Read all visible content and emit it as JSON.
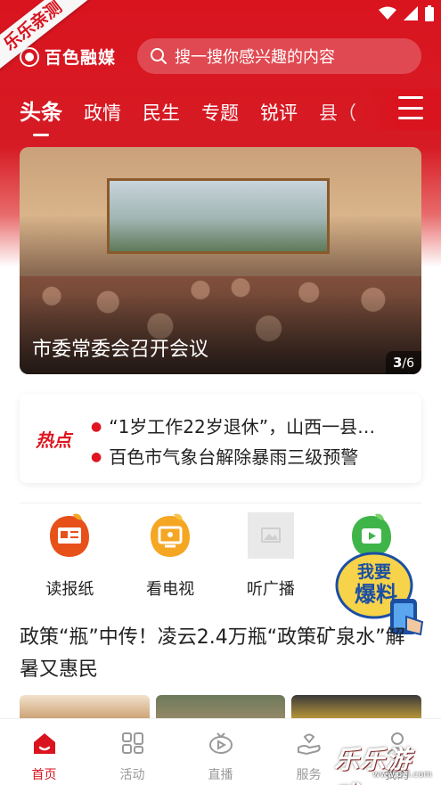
{
  "status_bar": {
    "icons": [
      "wifi-icon",
      "cellular-signal-icon",
      "battery-icon"
    ]
  },
  "ribbon": {
    "text": "乐乐亲测"
  },
  "app": {
    "name": "百色融媒"
  },
  "search": {
    "placeholder": "搜一搜你感兴趣的内容"
  },
  "tabs": [
    {
      "label": "头条",
      "active": true
    },
    {
      "label": "政情"
    },
    {
      "label": "民生"
    },
    {
      "label": "专题"
    },
    {
      "label": "锐评"
    },
    {
      "label": "县（"
    }
  ],
  "banner": {
    "title": "市委常委会召开会议",
    "page_current": "3",
    "page_total": "/6"
  },
  "hot": {
    "label": "热点",
    "items": [
      "“1岁工作22岁退休”，山西一县…",
      "百色市气象台解除暴雨三级预警"
    ]
  },
  "shortcuts": [
    {
      "label": "读报纸",
      "icon": "newspaper-icon"
    },
    {
      "label": "看电视",
      "icon": "tv-icon"
    },
    {
      "label": "听广播",
      "icon": "image-placeholder-icon"
    },
    {
      "label": "",
      "icon": "video-play-icon"
    }
  ],
  "report_button": {
    "line1": "我要",
    "line2": "爆料"
  },
  "headline": {
    "text": "政策“瓶”中传！凌云2.4万瓶“政策矿泉水”解暑又惠民"
  },
  "bottom_nav": [
    {
      "label": "首页",
      "icon": "home-icon",
      "active": true
    },
    {
      "label": "活动",
      "icon": "activity-grid-icon"
    },
    {
      "label": "直播",
      "icon": "live-play-icon"
    },
    {
      "label": "服务",
      "icon": "service-hand-icon"
    },
    {
      "label": "我的",
      "icon": "user-icon"
    }
  ],
  "watermark": {
    "text": "乐乐游戏",
    "url": "www.61l.com"
  },
  "colors": {
    "brand_red": "#d9141f",
    "hot_red": "#e0151f",
    "nav_inactive": "#999999"
  }
}
